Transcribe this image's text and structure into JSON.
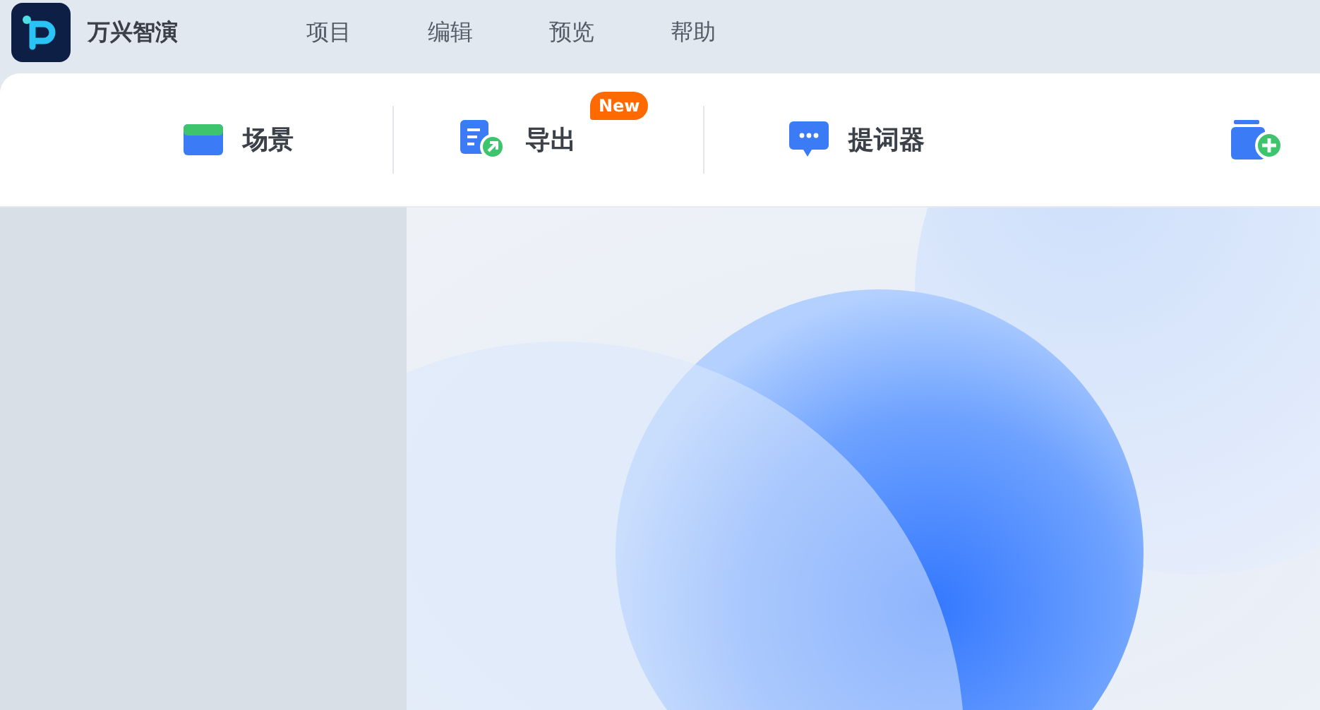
{
  "app": {
    "name": "万兴智演"
  },
  "menu": [
    {
      "label": "项目"
    },
    {
      "label": "编辑"
    },
    {
      "label": "预览"
    },
    {
      "label": "帮助"
    }
  ],
  "toolbar": [
    {
      "kind": "card",
      "label": "场景"
    },
    {
      "kind": "export",
      "label": "导出",
      "badge": "New"
    },
    {
      "kind": "chat",
      "label": "提词器"
    },
    {
      "kind": "folder"
    }
  ]
}
